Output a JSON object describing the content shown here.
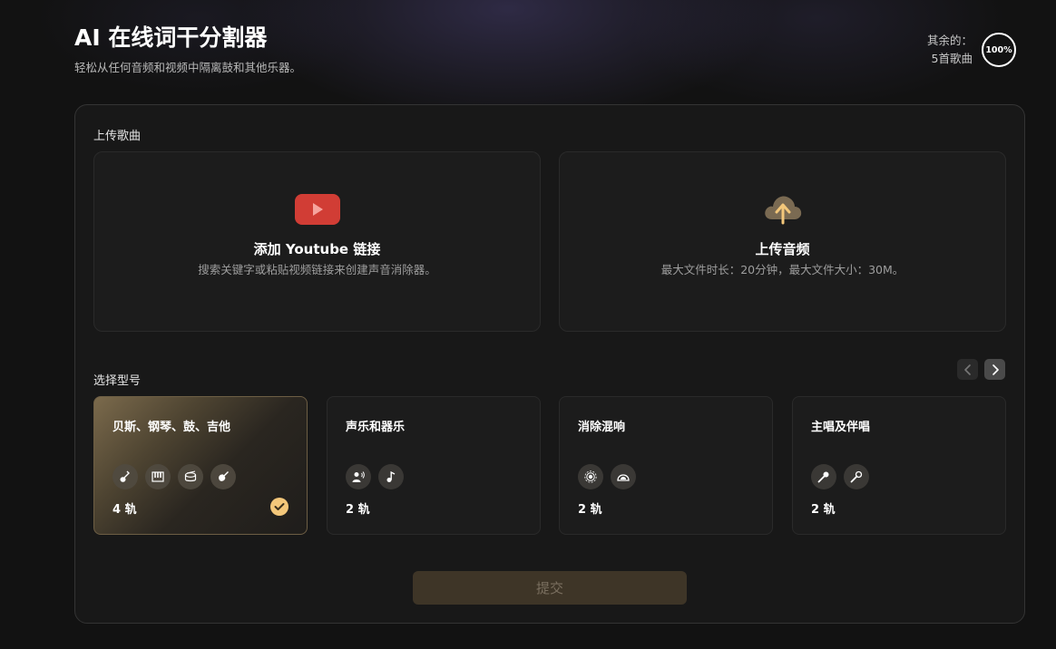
{
  "header": {
    "title": "AI 在线词干分割器",
    "subtitle": "轻松从任何音频和视频中隔离鼓和其他乐器。"
  },
  "quota": {
    "label": "其余的：",
    "count": "5首歌曲",
    "percent_label": "100%",
    "percent": 100
  },
  "upload": {
    "section_label": "上传歌曲",
    "youtube": {
      "icon": "youtube-icon",
      "title": "添加 Youtube 链接",
      "description": "搜索关键字或粘贴视频链接来创建声音消除器。"
    },
    "audio": {
      "icon": "cloud-upload-icon",
      "title": "上传音频",
      "description": "最大文件时长：20分钟，最大文件大小：30M。"
    }
  },
  "models": {
    "section_label": "选择型号",
    "items": [
      {
        "title": "贝斯、钢琴、鼓、吉他",
        "tracks": "4 轨",
        "selected": true,
        "icons": [
          "bass-icon",
          "piano-icon",
          "drum-icon",
          "guitar-icon"
        ]
      },
      {
        "title": "声乐和器乐",
        "tracks": "2 轨",
        "selected": false,
        "icons": [
          "vocal-icon",
          "music-note-icon"
        ]
      },
      {
        "title": "消除混响",
        "tracks": "2 轨",
        "selected": false,
        "icons": [
          "reverb-icon",
          "dry-signal-icon"
        ]
      },
      {
        "title": "主唱及伴唱",
        "tracks": "2 轨",
        "selected": false,
        "icons": [
          "microphone-icon",
          "microphone-icon"
        ]
      }
    ]
  },
  "submit": {
    "label": "提交"
  },
  "colors": {
    "accent": "#f3c77a",
    "youtube_red": "#d13d35",
    "upload_icon": "#f3c77a"
  }
}
